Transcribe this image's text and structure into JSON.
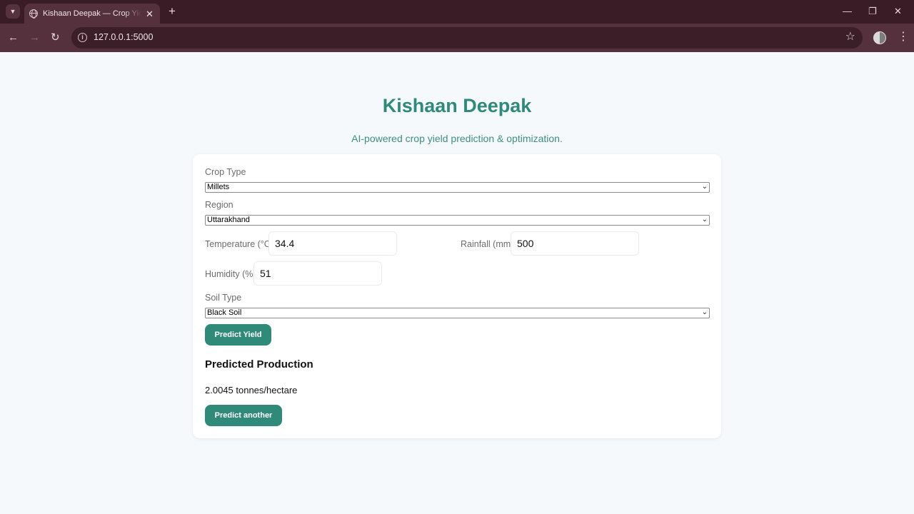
{
  "browser": {
    "tab_title": "Kishaan Deepak — Crop Yield Prediction",
    "tab_close": "✕",
    "new_tab": "+",
    "url": "127.0.0.1:5000",
    "icons": [
      "tab-search-icon",
      "globe-icon",
      "back-icon",
      "forward-icon",
      "reload-icon",
      "site-info-icon",
      "bookmark-star-icon",
      "profile-icon",
      "more-menu-icon",
      "minimize-icon",
      "restore-icon",
      "close-icon"
    ]
  },
  "header": {
    "title": "Kishaan Deepak",
    "subtitle": "AI-powered crop yield prediction & optimization."
  },
  "form": {
    "crop_type": {
      "label": "Crop Type",
      "value": "Millets"
    },
    "region": {
      "label": "Region",
      "value": "Uttarakhand"
    },
    "temperature": {
      "label": "Temperature (°C)",
      "value": "34.4"
    },
    "rainfall": {
      "label": "Rainfall (mm)",
      "value": "500"
    },
    "humidity": {
      "label": "Humidity (%)",
      "value": "51"
    },
    "soil_type": {
      "label": "Soil Type",
      "value": "Black Soil"
    },
    "submit_label": "Predict Yield"
  },
  "result": {
    "heading": "Predicted Production",
    "value": "2.0045 tonnes/hectare",
    "again_label": "Predict another"
  },
  "colors": {
    "accent": "#2f8a7a",
    "page_bg": "#f5f9fb",
    "chrome": "#3a1c26"
  }
}
